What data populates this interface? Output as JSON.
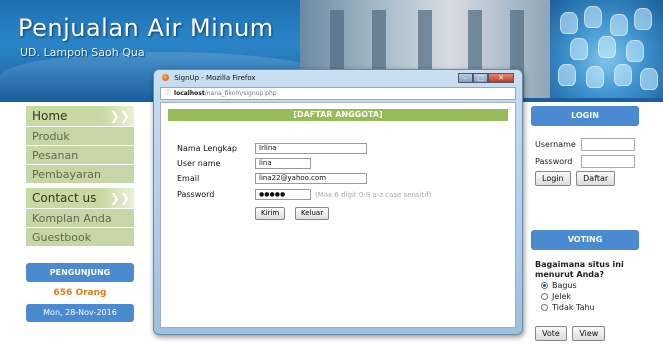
{
  "header": {
    "title": "Penjualan Air Minum",
    "subtitle": "UD. Lampoh Saoh Qua"
  },
  "menu": {
    "home": "Home",
    "produk": "Produk",
    "pesanan": "Pesanan",
    "pembayaran": "Pembayaran",
    "contact": "Contact us",
    "komplan": "Komplan Anda",
    "guestbook": "Guestbook",
    "arrow": "❯❯"
  },
  "counter": {
    "title": "PENGUNJUNG",
    "value": "656 Orang",
    "date": "Mon, 28-Nov-2016"
  },
  "login": {
    "title": "LOGIN",
    "username_label": "Username",
    "password_label": "Password",
    "login_button": "Login",
    "daftar_button": "Daftar"
  },
  "voting": {
    "title": "VOTING",
    "question": "Bagaimana situs ini menurut Anda?",
    "options": [
      "Bagus",
      "Jelek",
      "Tidak Tahu"
    ],
    "selected": "Bagus",
    "vote_button": "Vote",
    "view_button": "View"
  },
  "popup": {
    "window_title": "SignUp - Mozilla Firefox",
    "url_host": "localhost",
    "url_path": "/nana_fikom/signup.php",
    "form_title": "[DAFTAR ANGGOTA]",
    "nama_label": "Nama Lengkap",
    "nama_value": "Irlina",
    "username_label": "User name",
    "username_value": "lina",
    "email_label": "Email",
    "email_value": "lina22@yahoo.com",
    "password_label": "Password",
    "password_value": "●●●●●",
    "password_hint": "(Max 6 digit 0-9 a-z case sensitif)",
    "kirim_button": "Kirim",
    "keluar_button": "Keluar",
    "minimize": "–",
    "maximize": "□",
    "close": "✕",
    "info_icon": "ⓘ"
  },
  "colors": {
    "accent_blue": "#4a8ad1",
    "menu_green": "#c7d6a6",
    "form_header_green": "#97bb58",
    "counter_orange": "#e07b1a"
  }
}
